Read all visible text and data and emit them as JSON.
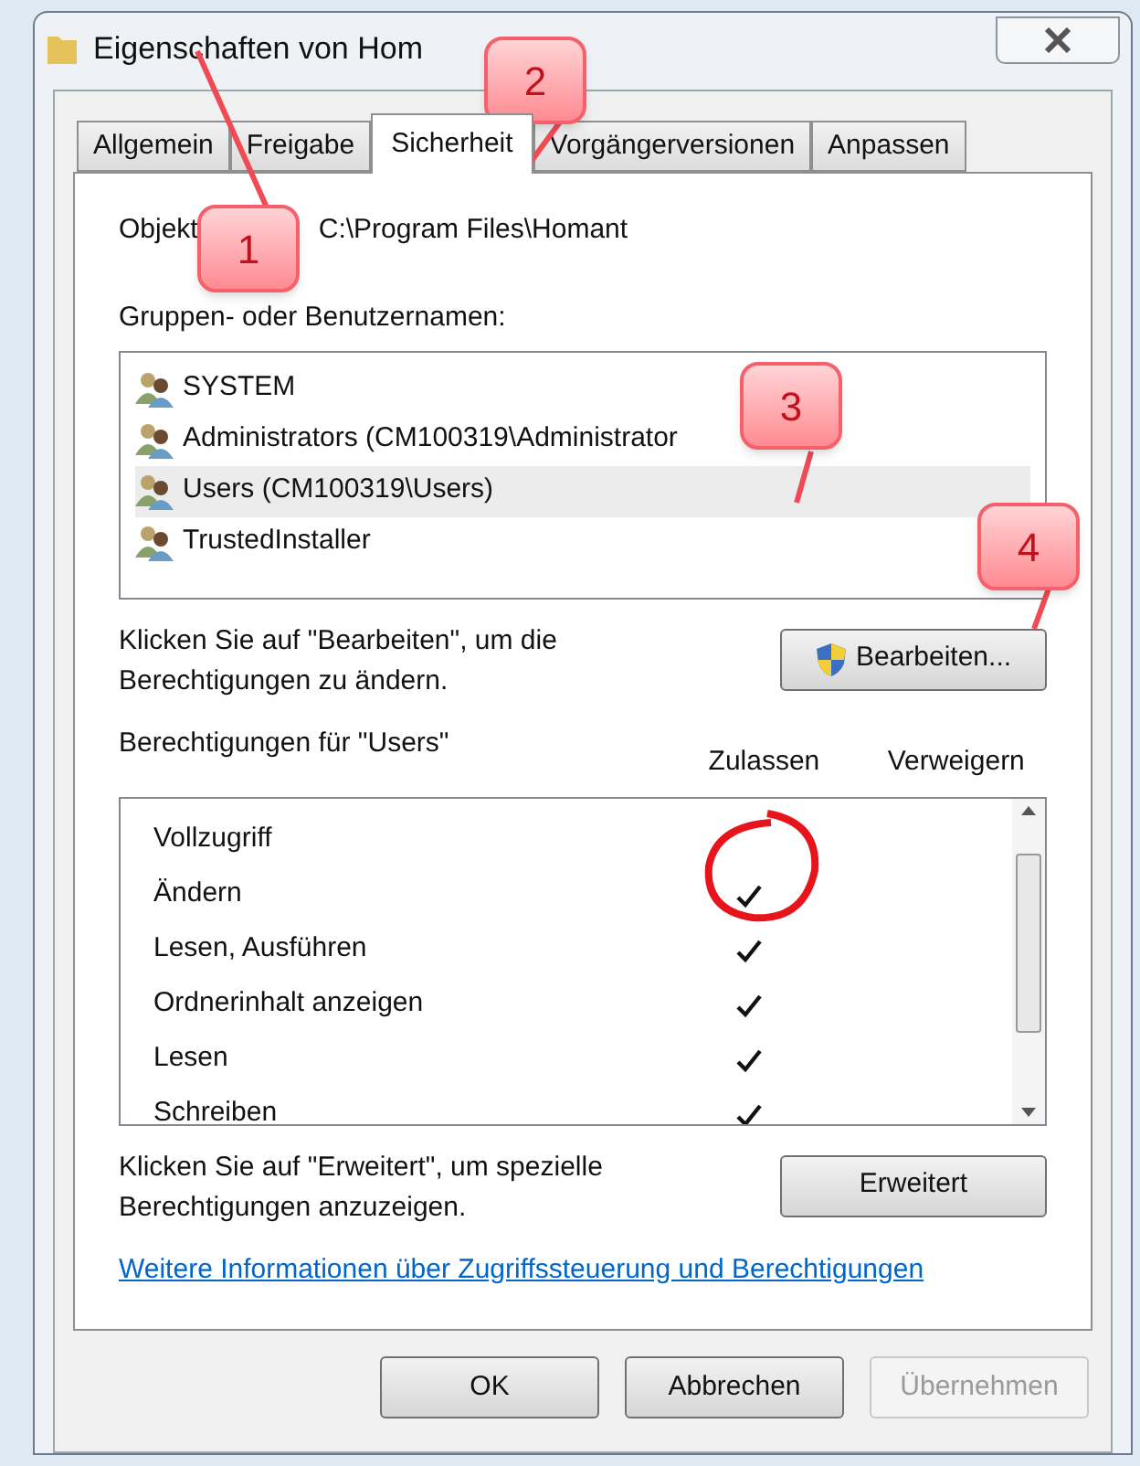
{
  "window": {
    "title": "Eigenschaften von Hom"
  },
  "tabs": [
    {
      "label": "Allgemein",
      "selected": false
    },
    {
      "label": "Freigabe",
      "selected": false
    },
    {
      "label": "Sicherheit",
      "selected": true
    },
    {
      "label": "Vorgängerversionen",
      "selected": false
    },
    {
      "label": "Anpassen",
      "selected": false
    }
  ],
  "object": {
    "label": "Objekt",
    "value": "C:\\Program Files\\Homant"
  },
  "groups": {
    "label": "Gruppen- oder Benutzernamen:",
    "items": [
      {
        "name": "SYSTEM",
        "selected": false
      },
      {
        "name": "Administrators (CM100319\\Administrator",
        "selected": false
      },
      {
        "name": "Users (CM100319\\Users)",
        "selected": true
      },
      {
        "name": "TrustedInstaller",
        "selected": false
      }
    ]
  },
  "edit_hint": "Klicken Sie auf \"Bearbeiten\", um die Berechtigungen zu ändern.",
  "edit_button": "Bearbeiten...",
  "permissions": {
    "label": "Berechtigungen für \"Users\"",
    "columns": [
      "Zulassen",
      "Verweigern"
    ],
    "rows": [
      {
        "name": "Vollzugriff",
        "allow": false,
        "deny": false
      },
      {
        "name": "Ändern",
        "allow": true,
        "deny": false
      },
      {
        "name": "Lesen, Ausführen",
        "allow": true,
        "deny": false
      },
      {
        "name": "Ordnerinhalt anzeigen",
        "allow": true,
        "deny": false
      },
      {
        "name": "Lesen",
        "allow": true,
        "deny": false
      },
      {
        "name": "Schreiben",
        "allow": true,
        "deny": false
      }
    ]
  },
  "advanced_hint": "Klicken Sie auf \"Erweitert\", um spezielle Berechtigungen anzuzeigen.",
  "advanced_button": "Erweitert",
  "link": "Weitere Informationen über Zugriffssteuerung und Berechtigungen",
  "buttons": [
    {
      "label": "OK",
      "disabled": false
    },
    {
      "label": "Abbrechen",
      "disabled": false
    },
    {
      "label": "Übernehmen",
      "disabled": true
    }
  ],
  "callouts": [
    {
      "label": "1"
    },
    {
      "label": "2"
    },
    {
      "label": "3"
    },
    {
      "label": "4"
    }
  ]
}
